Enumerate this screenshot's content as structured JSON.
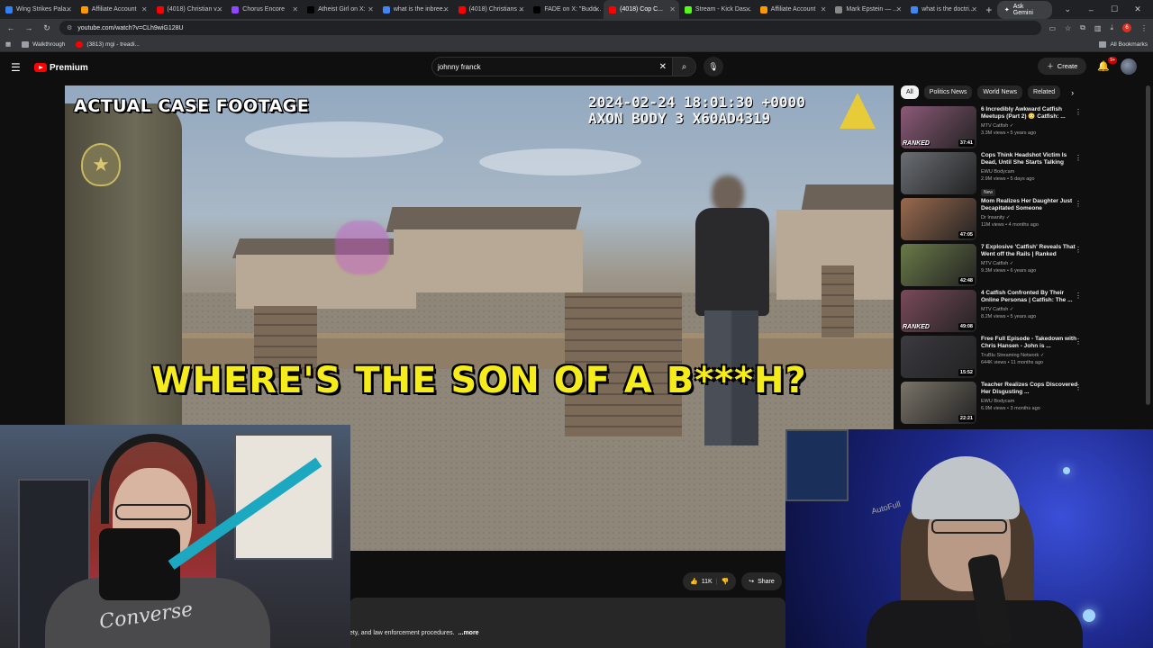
{
  "browser": {
    "tabs": [
      {
        "label": "Wing Strikes Pala...",
        "color": "#2f81f7"
      },
      {
        "label": "Affiliate Account",
        "color": "#ff9900"
      },
      {
        "label": "(4018) Christian v...",
        "color": "#ff0000"
      },
      {
        "label": "Chorus Encore",
        "color": "#9146ff"
      },
      {
        "label": "Atheist Girl on X:",
        "color": "#000000"
      },
      {
        "label": "what is the inbree...",
        "color": "#4285f4"
      },
      {
        "label": "(4018) Christians ...",
        "color": "#ff0000"
      },
      {
        "label": "FADE on X: \"Budd...",
        "color": "#000000"
      },
      {
        "label": "(4018) Cop C...",
        "color": "#ff0000",
        "active": true
      },
      {
        "label": "Stream - Kick Das...",
        "color": "#53fc18"
      },
      {
        "label": "Affiliate Account",
        "color": "#ff9900"
      },
      {
        "label": "Mark Epstein — ...",
        "color": "#888888"
      },
      {
        "label": "what is the doctri...",
        "color": "#4285f4"
      }
    ],
    "ask_gemini": "Ask Gemini",
    "url": "youtube.com/watch?v=CLh9wiG128U",
    "profile_initial": "6",
    "bookmarks": [
      {
        "label": "Walkthrough"
      },
      {
        "label": "(3813) mgi - treadi..."
      }
    ],
    "all_bookmarks": "All Bookmarks"
  },
  "youtube": {
    "logo_text": "Premium",
    "search_value": "johnny franck",
    "create_label": "Create",
    "notif_badge": "9+"
  },
  "video": {
    "overlay_title": "ACTUAL CASE FOOTAGE",
    "timestamp_line1": "2024-02-24 18:01:30 +0000",
    "timestamp_line2": "AXON BODY 3 X60AD4319",
    "caption": "WHERE'S THE SON OF A B***H?",
    "like_count": "11K",
    "share_label": "Share",
    "description_snippet": "ety, and law enforcement procedures.",
    "more_label": "...more"
  },
  "sidebar": {
    "chips": [
      "All",
      "Politics News",
      "World News",
      "Related"
    ],
    "related": [
      {
        "title": "6 Incredibly Awkward Catfish Meetups (Part 2) 😳 Catfish: ...",
        "channel": "MTV Catfish ✓",
        "views": "3.3M views • 5 years ago",
        "duration": "37:41",
        "ranked": "RANKED",
        "thumb": "#8c5a78"
      },
      {
        "title": "Cops Think Headshot Victim Is Dead, Until She Starts Talking",
        "channel": "EWU Bodycam",
        "views": "2.9M views • 5 days ago",
        "duration": "",
        "badge": "New",
        "thumb": "#6a6e74"
      },
      {
        "title": "Mom Realizes Her Daughter Just Decapitated Someone",
        "channel": "Dr Insanity ✓",
        "views": "11M views • 4 months ago",
        "duration": "47:05",
        "thumb": "#9a6a4e"
      },
      {
        "title": "7 Explosive 'Catfish' Reveals That Went off the Rails | Ranked",
        "channel": "MTV Catfish ✓",
        "views": "9.3M views • 6 years ago",
        "duration": "42:48",
        "thumb": "#6a7a48"
      },
      {
        "title": "4 Catfish Confronted By Their Online Personas | Catfish: The ...",
        "channel": "MTV Catfish ✓",
        "views": "8.2M views • 5 years ago",
        "duration": "49:08",
        "ranked": "RANKED",
        "thumb": "#7a4a5a"
      },
      {
        "title": "Free Full Episode - Takedown with Chris Hansen - John is ...",
        "channel": "TruBlu Streaming Network ✓",
        "views": "644K views • 11 months ago",
        "duration": "15:52",
        "thumb": "#3a3a40"
      },
      {
        "title": "Teacher Realizes Cops Discovered Her Disgusting ...",
        "channel": "EWU Bodycam",
        "views": "6.9M views • 3 months ago",
        "duration": "22:21",
        "thumb": "#7a7468"
      }
    ]
  },
  "webcam_left": {
    "shirt_text": "Converse"
  },
  "webcam_right": {
    "chair_text": "AutoFull"
  }
}
